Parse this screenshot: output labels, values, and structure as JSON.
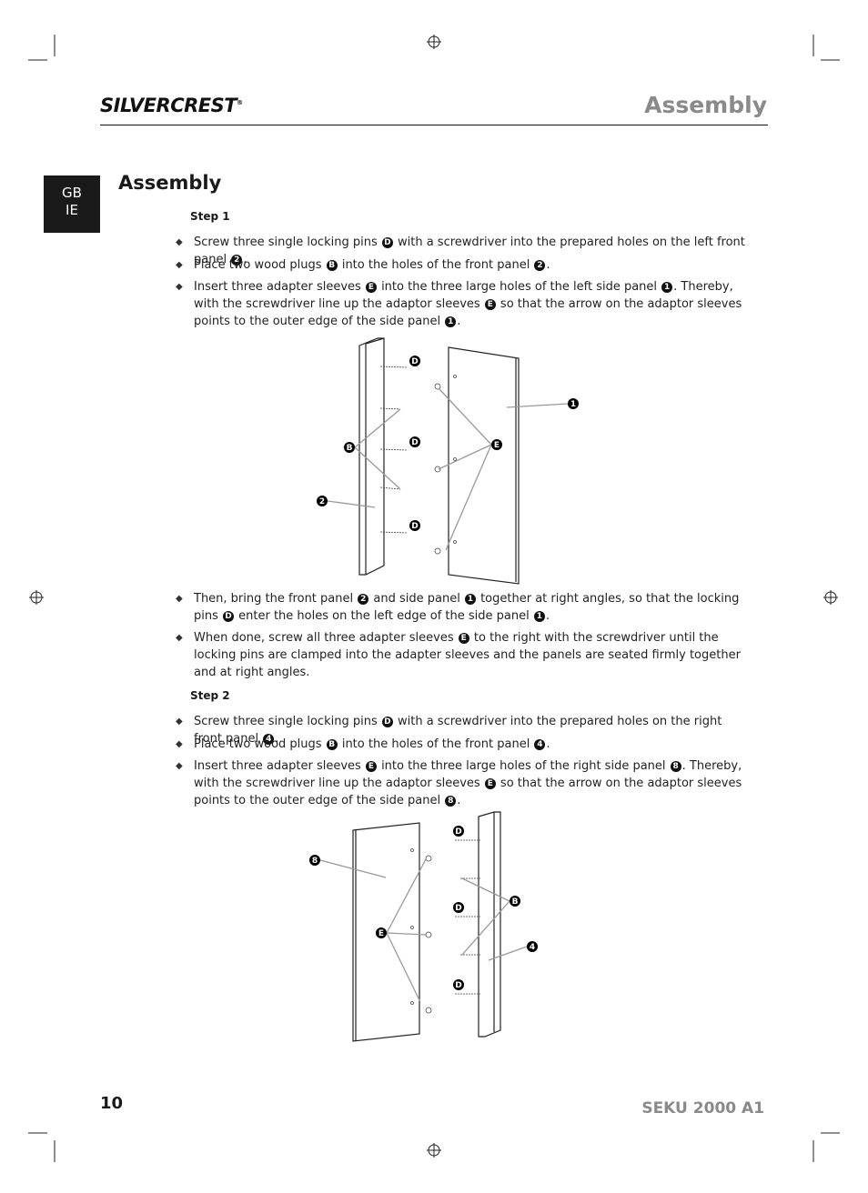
{
  "header": {
    "brand": "SilverCrest",
    "brand_mark": "®",
    "title": "Assembly"
  },
  "lang_tab": [
    "GB",
    "IE"
  ],
  "main_title": "Assembly",
  "step1": {
    "label": "Step 1",
    "bullets": [
      [
        {
          "t": "Screw three single locking pins "
        },
        {
          "b": "D"
        },
        {
          "t": " with a screwdriver into the prepared holes on the left front panel "
        },
        {
          "b": "2"
        },
        {
          "t": "."
        }
      ],
      [
        {
          "t": "Place two wood plugs "
        },
        {
          "b": "B"
        },
        {
          "t": " into the holes of the front panel "
        },
        {
          "b": "2"
        },
        {
          "t": "."
        }
      ],
      [
        {
          "t": "Insert three adapter sleeves "
        },
        {
          "b": "E"
        },
        {
          "t": " into the three large holes of the left side panel "
        },
        {
          "b": "1"
        },
        {
          "t": ". Thereby, with the screwdriver line up the adaptor sleeves "
        },
        {
          "b": "E"
        },
        {
          "t": " so that the arrow on the adaptor sleeves points to the outer edge of the side panel "
        },
        {
          "b": "1"
        },
        {
          "t": "."
        }
      ],
      [
        {
          "t": "Then, bring the front panel "
        },
        {
          "b": "2"
        },
        {
          "t": " and side panel "
        },
        {
          "b": "1"
        },
        {
          "t": " together at right angles, so that the locking pins "
        },
        {
          "b": "D"
        },
        {
          "t": " enter the holes on the left edge of the side panel "
        },
        {
          "b": "1"
        },
        {
          "t": "."
        }
      ],
      [
        {
          "t": "When done, screw all three adapter sleeves "
        },
        {
          "b": "E"
        },
        {
          "t": " to the right with the screwdriver until the locking pins are clamped into the adapter sleeves and the panels are seated firmly together and at right angles."
        }
      ]
    ],
    "diagram_labels": {
      "d": "D",
      "b": "B",
      "e": "E",
      "p1": "1",
      "p2": "2"
    }
  },
  "step2": {
    "label": "Step 2",
    "bullets": [
      [
        {
          "t": "Screw three single locking pins "
        },
        {
          "b": "D"
        },
        {
          "t": " with a screwdriver into the prepared holes on the right front panel "
        },
        {
          "b": "4"
        },
        {
          "t": "."
        }
      ],
      [
        {
          "t": "Place two wood plugs "
        },
        {
          "b": "B"
        },
        {
          "t": " into the holes of the front panel "
        },
        {
          "b": "4"
        },
        {
          "t": "."
        }
      ],
      [
        {
          "t": "Insert three adapter sleeves "
        },
        {
          "b": "E"
        },
        {
          "t": " into the three large holes of the right side panel "
        },
        {
          "b": "8"
        },
        {
          "t": ". Thereby, with the screwdriver line up the adaptor sleeves "
        },
        {
          "b": "E"
        },
        {
          "t": " so that the arrow on the adaptor sleeves points to the outer edge of the side panel "
        },
        {
          "b": "8"
        },
        {
          "t": "."
        }
      ]
    ],
    "diagram_labels": {
      "d": "D",
      "b": "B",
      "e": "E",
      "p8": "8",
      "p4": "4"
    }
  },
  "footer": {
    "page_number": "10",
    "model": "SEKU 2000 A1"
  }
}
